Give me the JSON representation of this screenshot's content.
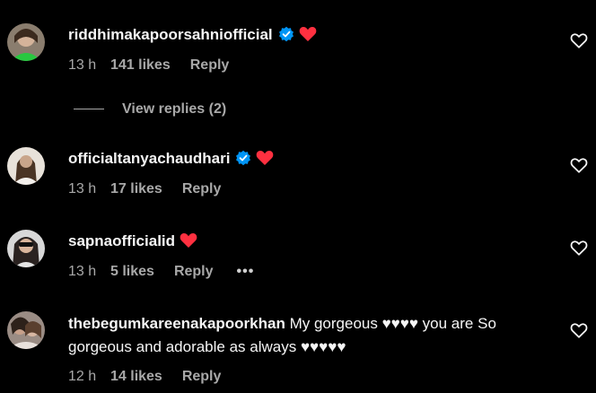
{
  "comments": [
    {
      "username": "riddhimakapoorsahniofficial",
      "verified": true,
      "text": "",
      "time": "13 h",
      "likes": "141 likes",
      "reply": "Reply"
    },
    {
      "username": "officialtanyachaudhari",
      "verified": true,
      "text": "",
      "time": "13 h",
      "likes": "17 likes",
      "reply": "Reply"
    },
    {
      "username": "sapnaofficialid",
      "verified": false,
      "text": "",
      "time": "13 h",
      "likes": "5 likes",
      "reply": "Reply",
      "more": "•••"
    },
    {
      "username": "thebegumkareenakapoorkhan",
      "verified": false,
      "text": " My gorgeous ♥♥♥♥ you are So gorgeous and adorable as always ♥♥♥♥♥",
      "time": "12 h",
      "likes": "14 likes",
      "reply": "Reply"
    }
  ],
  "view_replies": "View replies (2)",
  "colors": {
    "background": "#000000",
    "text": "#f5f5f5",
    "secondary": "#a8a8a8",
    "verified": "#0095f6",
    "heart": "#ff3040"
  }
}
